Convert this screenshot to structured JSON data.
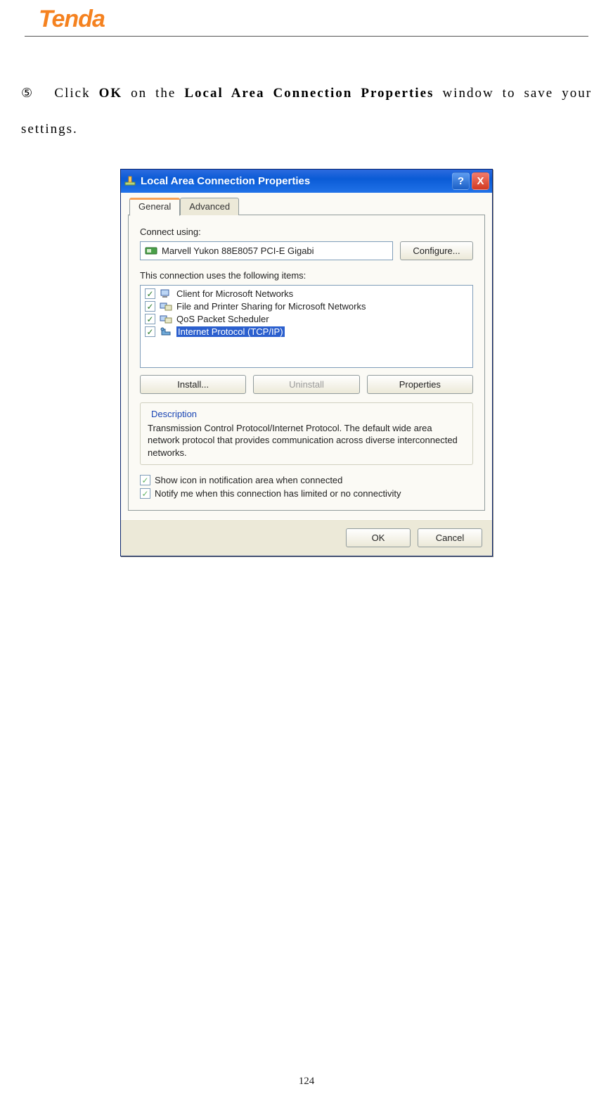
{
  "header": {
    "logo": "Tenda"
  },
  "instruction": {
    "step_marker": "⑤",
    "p1": "Click ",
    "b1": "OK",
    "p2": " on the ",
    "b2": "Local Area Connection Properties",
    "p3": " window to save your settings."
  },
  "dialog": {
    "title": "Local Area Connection Properties",
    "help_symbol": "?",
    "close_symbol": "X",
    "tabs": {
      "general": "General",
      "advanced": "Advanced"
    },
    "connect_using_label": "Connect using:",
    "adapter_name": "Marvell Yukon 88E8057 PCI-E Gigabi",
    "configure_btn": "Configure...",
    "items_label": "This connection uses the following items:",
    "items": [
      {
        "label": "Client for Microsoft Networks"
      },
      {
        "label": "File and Printer Sharing for Microsoft Networks"
      },
      {
        "label": "QoS Packet Scheduler"
      },
      {
        "label": "Internet Protocol (TCP/IP)"
      }
    ],
    "install_btn": "Install...",
    "uninstall_btn": "Uninstall",
    "properties_btn": "Properties",
    "description_legend": "Description",
    "description_text": "Transmission Control Protocol/Internet Protocol. The default wide area network protocol that provides communication across diverse interconnected networks.",
    "show_icon_label": "Show icon in notification area when connected",
    "notify_label": "Notify me when this connection has limited or no connectivity",
    "ok_btn": "OK",
    "cancel_btn": "Cancel"
  },
  "page_number": "124"
}
